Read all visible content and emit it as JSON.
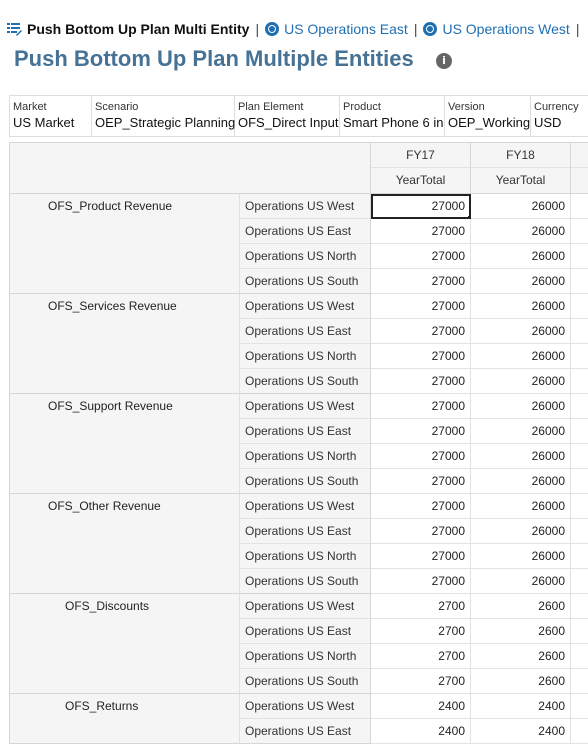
{
  "breadcrumb": {
    "current": "Push Bottom Up Plan Multi Entity",
    "links": [
      "US Operations East",
      "US Operations West"
    ],
    "separator": "|"
  },
  "page": {
    "title": "Push Bottom Up Plan Multiple Entities",
    "info_icon": "i"
  },
  "pov": [
    {
      "label": "Market",
      "value": "US Market"
    },
    {
      "label": "Scenario",
      "value": "OEP_Strategic Planning"
    },
    {
      "label": "Plan Element",
      "value": "OFS_Direct Input"
    },
    {
      "label": "Product",
      "value": "Smart Phone 6 in"
    },
    {
      "label": "Version",
      "value": "OEP_Working"
    },
    {
      "label": "Currency",
      "value": "USD"
    }
  ],
  "grid": {
    "columns": [
      {
        "year": "FY17",
        "period": "YearTotal"
      },
      {
        "year": "FY18",
        "period": "YearTotal"
      }
    ],
    "groups": [
      {
        "account": "OFS_Product Revenue",
        "rows": [
          {
            "entity": "Operations US West",
            "fy17": "27000",
            "fy18": "26000"
          },
          {
            "entity": "Operations US East",
            "fy17": "27000",
            "fy18": "26000"
          },
          {
            "entity": "Operations US North",
            "fy17": "27000",
            "fy18": "26000"
          },
          {
            "entity": "Operations US South",
            "fy17": "27000",
            "fy18": "26000"
          }
        ]
      },
      {
        "account": "OFS_Services Revenue",
        "rows": [
          {
            "entity": "Operations US West",
            "fy17": "27000",
            "fy18": "26000"
          },
          {
            "entity": "Operations US East",
            "fy17": "27000",
            "fy18": "26000"
          },
          {
            "entity": "Operations US North",
            "fy17": "27000",
            "fy18": "26000"
          },
          {
            "entity": "Operations US South",
            "fy17": "27000",
            "fy18": "26000"
          }
        ]
      },
      {
        "account": "OFS_Support Revenue",
        "rows": [
          {
            "entity": "Operations US West",
            "fy17": "27000",
            "fy18": "26000"
          },
          {
            "entity": "Operations US East",
            "fy17": "27000",
            "fy18": "26000"
          },
          {
            "entity": "Operations US North",
            "fy17": "27000",
            "fy18": "26000"
          },
          {
            "entity": "Operations US South",
            "fy17": "27000",
            "fy18": "26000"
          }
        ]
      },
      {
        "account": "OFS_Other Revenue",
        "rows": [
          {
            "entity": "Operations US West",
            "fy17": "27000",
            "fy18": "26000"
          },
          {
            "entity": "Operations US East",
            "fy17": "27000",
            "fy18": "26000"
          },
          {
            "entity": "Operations US North",
            "fy17": "27000",
            "fy18": "26000"
          },
          {
            "entity": "Operations US South",
            "fy17": "27000",
            "fy18": "26000"
          }
        ]
      },
      {
        "account": "OFS_Discounts",
        "rows": [
          {
            "entity": "Operations US West",
            "fy17": "2700",
            "fy18": "2600"
          },
          {
            "entity": "Operations US East",
            "fy17": "2700",
            "fy18": "2600"
          },
          {
            "entity": "Operations US North",
            "fy17": "2700",
            "fy18": "2600"
          },
          {
            "entity": "Operations US South",
            "fy17": "2700",
            "fy18": "2600"
          }
        ]
      },
      {
        "account": "OFS_Returns",
        "rows": [
          {
            "entity": "Operations US West",
            "fy17": "2400",
            "fy18": "2400"
          },
          {
            "entity": "Operations US East",
            "fy17": "2400",
            "fy18": "2400"
          }
        ]
      }
    ]
  },
  "colors": {
    "title": "#467296",
    "link": "#1f6fb2",
    "header_bg": "#f5f5f5"
  }
}
